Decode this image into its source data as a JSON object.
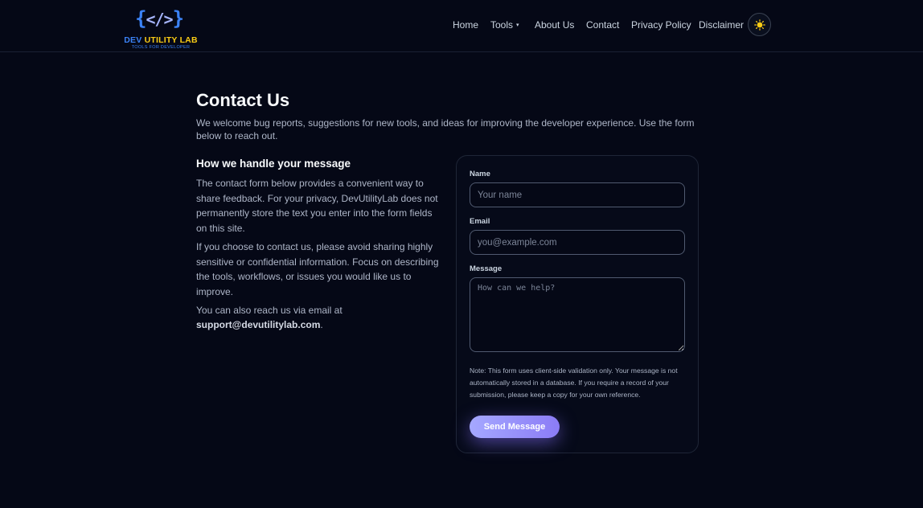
{
  "brand": {
    "mark_open": "{",
    "mark_slash": "</>",
    "mark_close": "}",
    "name_dev": "DEV",
    "name_rest": "UTILITY LAB",
    "tagline": "TOOLS FOR DEVELOPER"
  },
  "nav": {
    "items": [
      "Home",
      "Tools",
      "About Us",
      "Contact",
      "Privacy Policy",
      "Disclaimer"
    ],
    "tools_caret": "▾",
    "theme_toggle_icon": "sun-icon"
  },
  "page": {
    "title": "Contact Us",
    "intro": "We welcome bug reports, suggestions for new tools, and ideas for improving the developer experience. Use the form below to reach out."
  },
  "info": {
    "heading": "How we handle your message",
    "p1": "The contact form below provides a convenient way to share feedback. For your privacy, DevUtilityLab does not permanently store the text you enter into the form fields on this site.",
    "p2": "If you choose to contact us, please avoid sharing highly sensitive or confidential information. Focus on describing the tools, workflows, or issues you would like us to improve.",
    "p3_prefix": "You can also reach us via email at",
    "email": "support@devutilitylab.com",
    "p3_suffix": "."
  },
  "form": {
    "name_label": "Name",
    "name_placeholder": "Your name",
    "email_label": "Email",
    "email_placeholder": "you@example.com",
    "message_label": "Message",
    "message_placeholder": "How can we help?",
    "note": "Note: This form uses client-side validation only. Your message is not automatically stored in a database. If you require a record of your submission, please keep a copy for your own reference.",
    "submit_label": "Send Message"
  },
  "colors": {
    "background": "#050816",
    "accent": "#8b7cf6",
    "brand_blue": "#3b82f6",
    "brand_yellow": "#facc15"
  }
}
